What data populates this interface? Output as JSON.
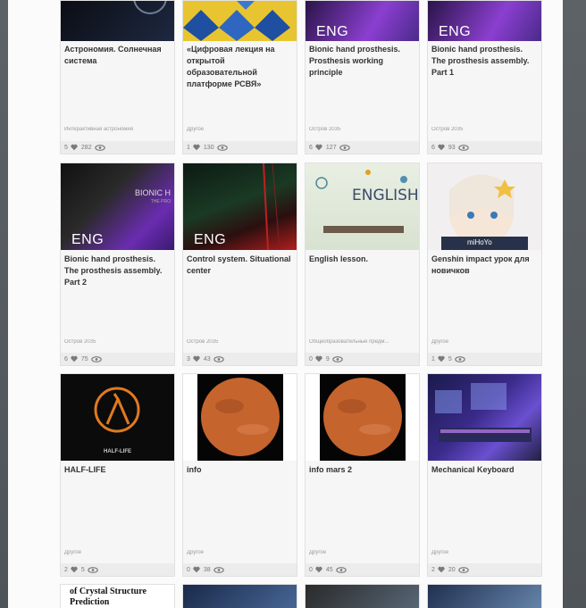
{
  "cards": [
    {
      "id": "c1",
      "title": "Астрономия. Солнечная система",
      "category": "Интерактивная астрономия",
      "likes": "5",
      "views": "282"
    },
    {
      "id": "c2",
      "title": "«Цифровая лекция на открытой образовательной платформе РСВЯ»",
      "category": "Другое",
      "likes": "1",
      "views": "130"
    },
    {
      "id": "c3",
      "title": "Bionic hand prosthesis. Prosthesis working principle",
      "category": "Остров 2035",
      "likes": "6",
      "views": "127",
      "badge": "ENG"
    },
    {
      "id": "c4",
      "title": "Bionic hand prosthesis. The prosthesis assembly. Part 1",
      "category": "Остров 2035",
      "likes": "6",
      "views": "93",
      "badge": "ENG"
    },
    {
      "id": "c5",
      "title": "Bionic hand prosthesis. The prosthesis assembly. Part 2",
      "category": "Остров 2035",
      "likes": "6",
      "views": "75",
      "badge": "ENG",
      "thumb_text": "BIONIC H",
      "thumb_subtext": "THE PRO"
    },
    {
      "id": "c6",
      "title": "Control system. Situational center",
      "category": "Остров 2035",
      "likes": "3",
      "views": "43",
      "badge": "ENG"
    },
    {
      "id": "c7",
      "title": "English lesson.",
      "category": "Общеобразовательные предм...",
      "likes": "0",
      "views": "9",
      "thumb_text": "ENGLISH"
    },
    {
      "id": "c8",
      "title": "Genshin impact урок для новичков",
      "category": "Другое",
      "likes": "1",
      "views": "5",
      "thumb_text": "miHoYo"
    },
    {
      "id": "c9",
      "title": "HALF-LIFE",
      "category": "Другое",
      "likes": "2",
      "views": "5",
      "thumb_text": "HALF-LIFE"
    },
    {
      "id": "c10",
      "title": "info",
      "category": "Другое",
      "likes": "0",
      "views": "38"
    },
    {
      "id": "c11",
      "title": "info mars 2",
      "category": "Другое",
      "likes": "0",
      "views": "45"
    },
    {
      "id": "c12",
      "title": "Mechanical Keyboard",
      "category": "Другое",
      "likes": "2",
      "views": "20"
    }
  ],
  "partial_row": {
    "first_title": "of Crystal Structure Prediction"
  },
  "colors": {
    "accent_purple": "#7a3fb0",
    "mars": "#c2622e",
    "page_bg": "#fbfbfb"
  }
}
